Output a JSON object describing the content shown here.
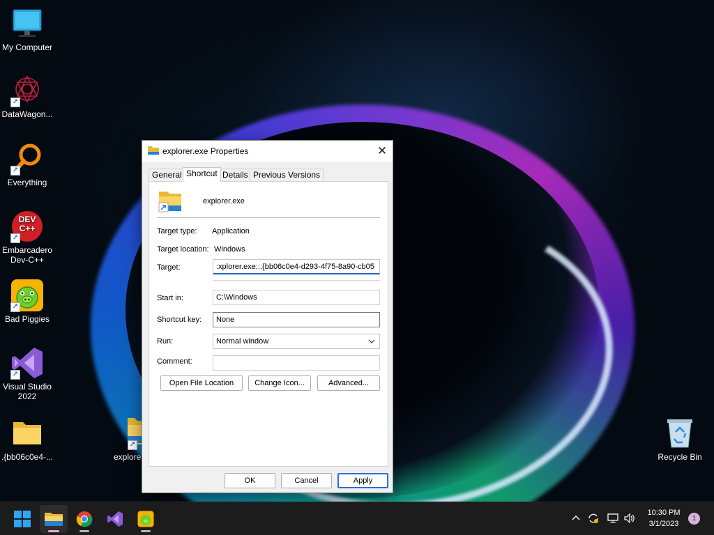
{
  "desktop": {
    "icons": [
      {
        "label": "My Computer",
        "icon": "computer-icon"
      },
      {
        "label": "DataWagon...",
        "icon": "datawagon-icon"
      },
      {
        "label": "Everything",
        "icon": "everything-search-icon"
      },
      {
        "label": "Embarcadero Dev-C++",
        "icon": "devcpp-icon",
        "badge": "DEV C++"
      },
      {
        "label": "Bad Piggies",
        "icon": "bad-piggies-icon"
      },
      {
        "label": "Visual Studio 2022",
        "icon": "visual-studio-icon"
      },
      {
        "label": ".{bb06c0e4-...",
        "icon": "folder-icon"
      },
      {
        "label": "explorer",
        "icon": "explorer-shortcut-icon"
      },
      {
        "label": "Recycle Bin",
        "icon": "recycle-bin-icon"
      }
    ]
  },
  "dialog": {
    "title": "explorer.exe Properties",
    "close": "✕",
    "tabs": [
      "General",
      "Shortcut",
      "Details",
      "Previous Versions"
    ],
    "active_tab": "Shortcut",
    "file_name": "explorer.exe",
    "target_type_label": "Target type:",
    "target_type_value": "Application",
    "target_location_label": "Target location:",
    "target_location_value": "Windows",
    "target_label": "Target:",
    "target_value": ":xplorer.exe:::{bb06c0e4-d293-4f75-8a90-cb05",
    "start_in_label": "Start in:",
    "start_in_value": "C:\\Windows",
    "shortcut_key_label": "Shortcut key:",
    "shortcut_key_value": "None",
    "run_label": "Run:",
    "run_value": "Normal window",
    "comment_label": "Comment:",
    "comment_value": "",
    "buttons": {
      "open_file_location": "Open File Location",
      "change_icon": "Change Icon...",
      "advanced": "Advanced...",
      "ok": "OK",
      "cancel": "Cancel",
      "apply": "Apply"
    }
  },
  "taskbar": {
    "apps": [
      "start-icon",
      "file-explorer-icon",
      "chrome-icon",
      "visual-studio-icon",
      "bad-piggies-icon"
    ],
    "tray": {
      "time": "10:30 PM",
      "date": "3/1/2023",
      "notification_count": "1"
    }
  },
  "colors": {
    "accent": "#2565b8",
    "taskbar": "#1c1c1c",
    "dialog_bg": "#f0f0f0"
  }
}
